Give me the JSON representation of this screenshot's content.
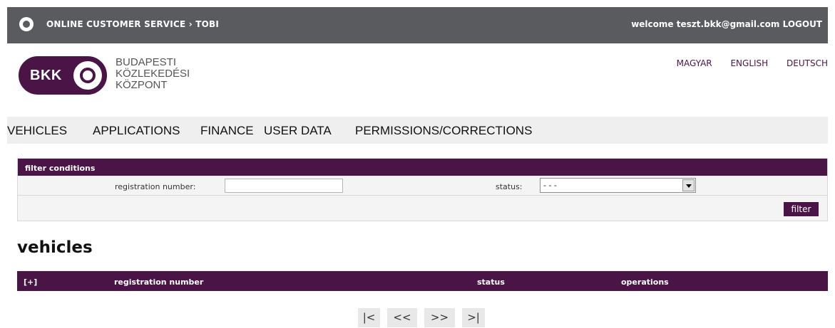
{
  "topbar": {
    "breadcrumb": "ONLINE CUSTOMER SERVICE › TOBI",
    "welcome": "welcome teszt.bkk@gmail.com",
    "logout": "LOGOUT"
  },
  "logo": {
    "mark": "BKK",
    "line1": "BUDAPESTI",
    "line2": "KÖZLEKEDÉSI",
    "line3": "KÖZPONT"
  },
  "languages": [
    "MAGYAR",
    "ENGLISH",
    "DEUTSCH"
  ],
  "nav": [
    "VEHICLES",
    "APPLICATIONS",
    "FINANCE",
    "USER DATA",
    "PERMISSIONS/CORRECTIONS"
  ],
  "filter": {
    "heading": "filter conditions",
    "reg_label": "registration number:",
    "reg_value": "",
    "status_label": "status:",
    "status_value": "- - -",
    "button": "filter"
  },
  "vehicles": {
    "title": "vehicles",
    "columns": [
      "[+]",
      "registration number",
      "status",
      "operations"
    ]
  },
  "pager": [
    "|<",
    "<<",
    ">>",
    ">|"
  ],
  "colors": {
    "accent": "#4a1446",
    "topbar": "#5a5b5e"
  }
}
